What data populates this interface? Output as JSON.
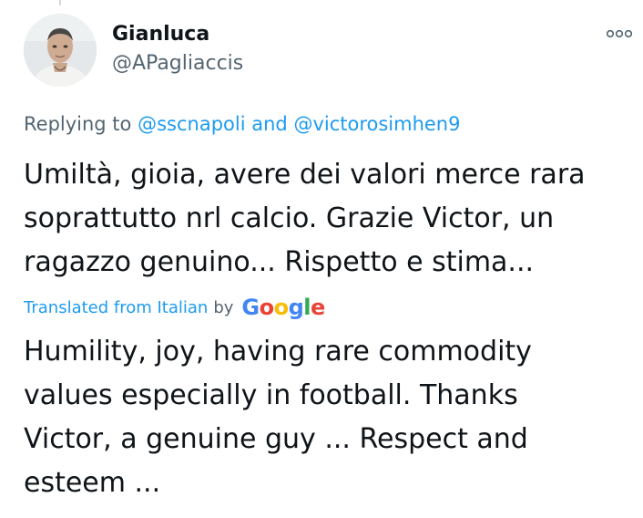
{
  "user": {
    "display_name": "Gianluca",
    "handle": "@APagliaccis",
    "more_icon": "ellipsis-icon"
  },
  "reply": {
    "prefix": "Replying to",
    "mention_1": "@sscnapoli",
    "conjunction": "and",
    "mention_2": "@victorosimhen9"
  },
  "tweet": {
    "lines": [
      "Umiltà, gioia, avere dei valori merce rara",
      "soprattutto nrl calcio. Grazie Victor, un",
      "ragazzo genuino... Rispetto e stima..."
    ]
  },
  "translation": {
    "label": "Translated from Italian",
    "by": "by",
    "provider_letters": [
      "G",
      "o",
      "o",
      "g",
      "l",
      "e"
    ],
    "provider_colors": [
      "#4285f4",
      "#ea4335",
      "#fbbc05",
      "#4285f4",
      "#34a853",
      "#ea4335"
    ],
    "lines": [
      "Humility, joy, having rare commodity",
      "values especially in football. Thanks",
      "Victor, a genuine guy ... Respect and",
      "esteem ..."
    ]
  },
  "colors": {
    "accent": "#1d9bf0",
    "secondary_text": "#536471",
    "primary_text": "#0f1419"
  }
}
